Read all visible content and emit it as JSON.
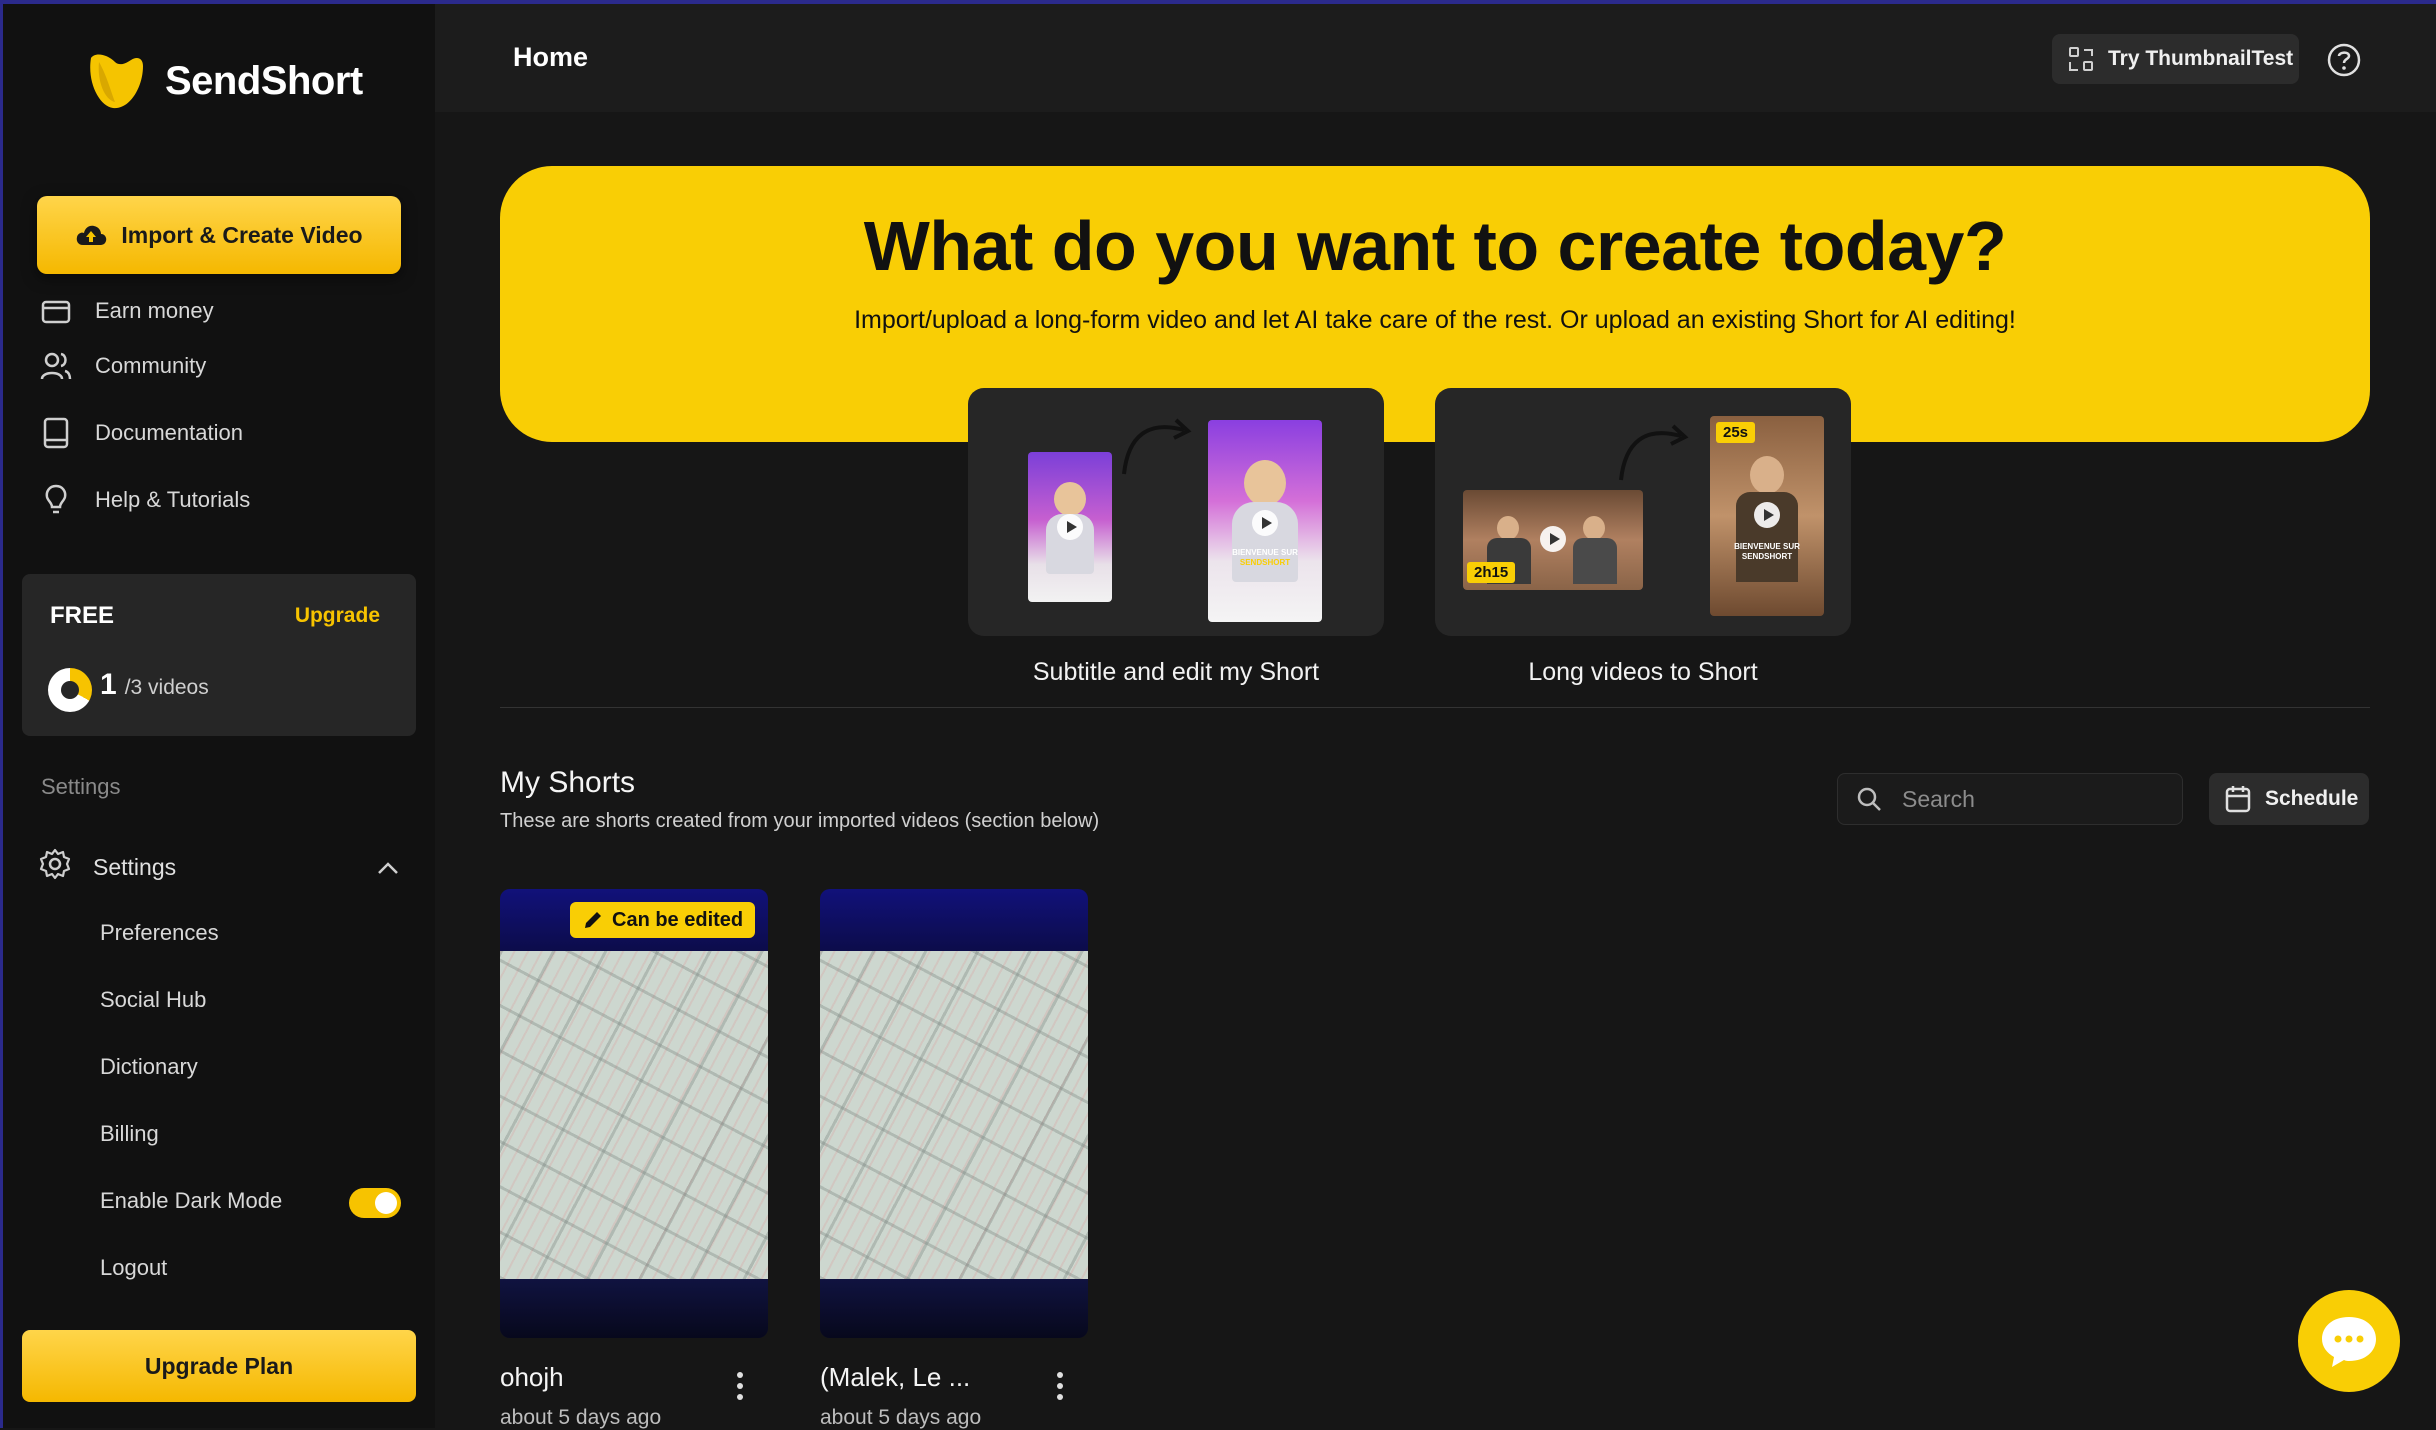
{
  "app": {
    "name": "SendShort"
  },
  "sidebar": {
    "import_button": "Import & Create Video",
    "nav": [
      {
        "label": "Earn money",
        "icon": "wallet-icon"
      },
      {
        "label": "Community",
        "icon": "users-icon"
      },
      {
        "label": "Documentation",
        "icon": "book-icon"
      },
      {
        "label": "Help & Tutorials",
        "icon": "lightbulb-icon"
      }
    ],
    "plan": {
      "name": "FREE",
      "upgrade": "Upgrade",
      "used": "1",
      "total": "/3 videos"
    },
    "settings_section": "Settings",
    "settings_label": "Settings",
    "settings_items": [
      "Preferences",
      "Social Hub",
      "Dictionary",
      "Billing",
      "Enable Dark Mode",
      "Logout"
    ],
    "dark_mode_enabled": true,
    "upgrade_plan": "Upgrade Plan"
  },
  "header": {
    "title": "Home",
    "try_button": "Try ThumbnailTest"
  },
  "hero": {
    "title": "What do you want to create today?",
    "subtitle": "Import/upload a long-form video and let AI take care of the rest. Or upload an existing Short for AI editing!",
    "options": [
      {
        "label": "Subtitle and edit my Short",
        "thumb_caption_line1": "BIENVENUE SUR",
        "thumb_caption_line2": "SENDSHORT"
      },
      {
        "label": "Long videos to Short",
        "duration_long": "2h15",
        "duration_short": "25s",
        "thumb_caption_line1": "BIENVENUE SUR",
        "thumb_caption_line2": "SENDSHORT"
      }
    ]
  },
  "shorts": {
    "title": "My Shorts",
    "subtitle": "These are shorts created from your imported videos (section below)",
    "search_placeholder": "Search",
    "schedule_button": "Schedule",
    "items": [
      {
        "name": "ohojh",
        "date": "about 5 days ago",
        "badge": "Can be edited"
      },
      {
        "name": "(Malek, Le ...",
        "date": "about 5 days ago"
      }
    ]
  },
  "colors": {
    "accent": "#f9ce05",
    "background": "#161616",
    "sidebar": "#111111"
  }
}
